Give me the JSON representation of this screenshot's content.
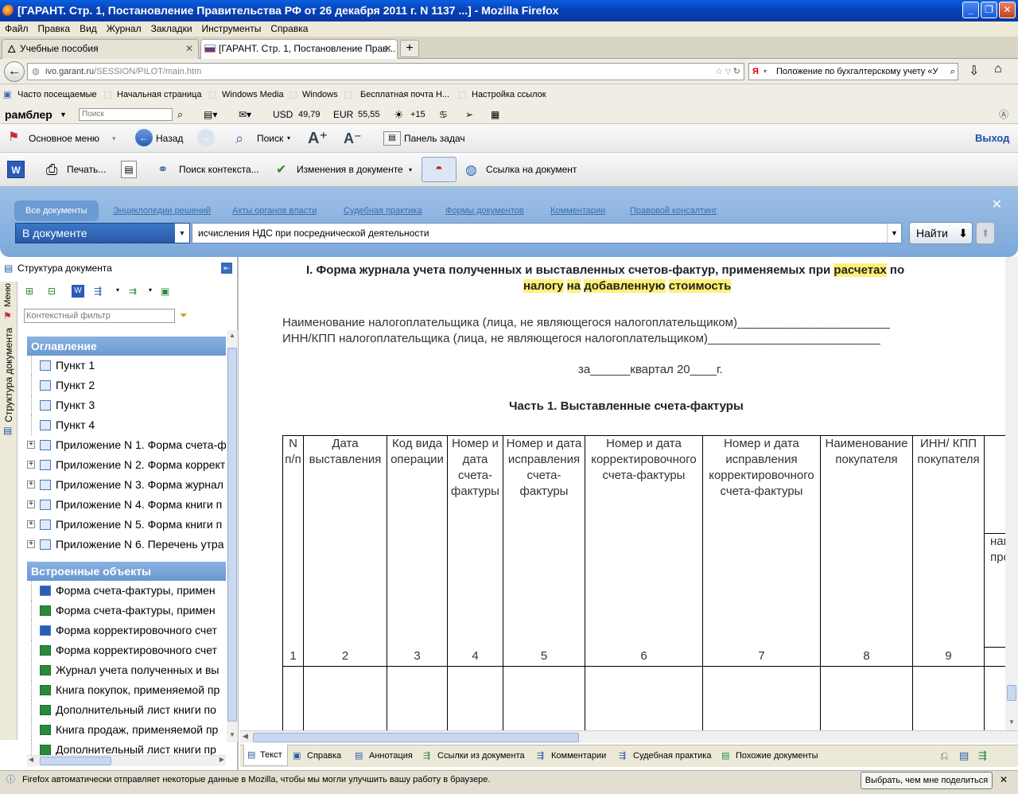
{
  "window": {
    "title": "[ГАРАНТ. Стр. 1, Постановление Правительства РФ от 26 декабря 2011 г. N 1137 ...] - Mozilla Firefox"
  },
  "menu": [
    "Файл",
    "Правка",
    "Вид",
    "Журнал",
    "Закладки",
    "Инструменты",
    "Справка"
  ],
  "tabs": [
    {
      "label": "Учебные пособия"
    },
    {
      "label": "[ГАРАНТ. Стр. 1, Постановление Прав..."
    }
  ],
  "nav": {
    "url_host": "ivo.garant.ru",
    "url_path": "/SESSION/PILOT/main.htm",
    "search_value": "Положение по бухгалтерскому учету «У"
  },
  "bookmarks": [
    "Часто посещаемые",
    "Начальная страница",
    "Windows Media",
    "Windows",
    "Бесплатная почта Н...",
    "Настройка ссылок"
  ],
  "rambler": {
    "logo": "рамблер",
    "placeholder": "Поиск",
    "usd_label": "USD",
    "usd_value": "49,79",
    "eur_label": "EUR",
    "eur_value": "55,55",
    "weather": "+15"
  },
  "toolbar1": {
    "main_menu": "Основное меню",
    "back": "Назад",
    "search": "Поиск",
    "tasks": "Панель задач",
    "exit": "Выход"
  },
  "toolbar2": {
    "print": "Печать...",
    "context_search": "Поиск контекста...",
    "changes": "Изменения в документе",
    "link": "Ссылка на документ"
  },
  "search_panel": {
    "tabs": [
      "Все документы",
      "Энциклопедии решений",
      "Акты органов власти",
      "Судебная практика",
      "Формы документов",
      "Комментарии",
      "Правовой консалтинг"
    ],
    "scope": "В документе",
    "query": "исчисления НДС при посреднической деятельности",
    "find": "Найти"
  },
  "left_tabs": {
    "menu": "Меню",
    "structure": "Структура документа"
  },
  "structure": {
    "title": "Структура документа",
    "filter_placeholder": "Контекстный фильтр",
    "toc_title": "Оглавление",
    "toc": [
      {
        "label": "Пункт 1",
        "expandable": false
      },
      {
        "label": "Пункт 2",
        "expandable": false
      },
      {
        "label": "Пункт 3",
        "expandable": false
      },
      {
        "label": "Пункт 4",
        "expandable": false
      },
      {
        "label": "Приложение N 1. Форма счета-ф",
        "expandable": true
      },
      {
        "label": "Приложение N 2. Форма коррект",
        "expandable": true
      },
      {
        "label": "Приложение N 3. Форма журнал",
        "expandable": true
      },
      {
        "label": "Приложение N 4. Форма книги п",
        "expandable": true
      },
      {
        "label": "Приложение N 5. Форма книги п",
        "expandable": true
      },
      {
        "label": "Приложение N 6. Перечень утра",
        "expandable": true
      }
    ],
    "embedded_title": "Встроенные объекты",
    "embedded": [
      {
        "label": "Форма счета-фактуры, примен",
        "type": "word"
      },
      {
        "label": "Форма счета-фактуры, примен",
        "type": "excel"
      },
      {
        "label": "Форма корректировочного счет",
        "type": "word"
      },
      {
        "label": "Форма корректировочного счет",
        "type": "excel"
      },
      {
        "label": "Журнал учета полученных и вы",
        "type": "excel"
      },
      {
        "label": "Книга покупок, применяемой пр",
        "type": "excel"
      },
      {
        "label": "Дополнительный лист книги по",
        "type": "excel"
      },
      {
        "label": "Книга продаж, применяемой пр",
        "type": "excel"
      },
      {
        "label": "Дополнительный лист книги пр",
        "type": "excel"
      }
    ]
  },
  "document": {
    "heading_line1_a": "I. Форма журнала учета полученных и выставленных счетов-фактур, применяемых при ",
    "heading_line1_hl": "расчетах",
    "heading_line1_b": " по",
    "heading_line2": [
      "налогу",
      "на",
      "добавленную",
      "стоимость"
    ],
    "line_taxpayer": "Наименование налогоплательщика (лица, не являющегося налогоплательщиком)_______________________",
    "line_inn": "ИНН/КПП налогоплательщика (лица, не являющегося налогоплательщиком)__________________________",
    "line_quarter": "за______квартал 20____г.",
    "part1": "Часть 1. Выставленные счета-фактуры",
    "columns": [
      {
        "header": "N п/п",
        "num": "1"
      },
      {
        "header": "Дата выставления",
        "num": "2"
      },
      {
        "header": "Код вида операции",
        "num": "3"
      },
      {
        "header": "Номер и дата счета-фактуры",
        "num": "4"
      },
      {
        "header": "Номер и дата исправления счета-фактуры",
        "num": "5"
      },
      {
        "header": "Номер и дата корректировочного счета-фактуры",
        "num": "6"
      },
      {
        "header": "Номер и дата исправления корректировочного счета-фактуры",
        "num": "7"
      },
      {
        "header": "Наименование покупателя",
        "num": "8"
      },
      {
        "header": "ИНН/ КПП покупателя",
        "num": "9"
      }
    ],
    "partial_col": "наи про"
  },
  "bottom_tabs": [
    "Текст",
    "Справка",
    "Аннотация",
    "Ссылки из документа",
    "Комментарии",
    "Судебная практика",
    "Похожие документы"
  ],
  "statusbar": {
    "message": "Firefox автоматически отправляет некоторые данные в Mozilla, чтобы мы могли улучшить вашу работу в браузере.",
    "button": "Выбрать, чем мне поделиться"
  }
}
